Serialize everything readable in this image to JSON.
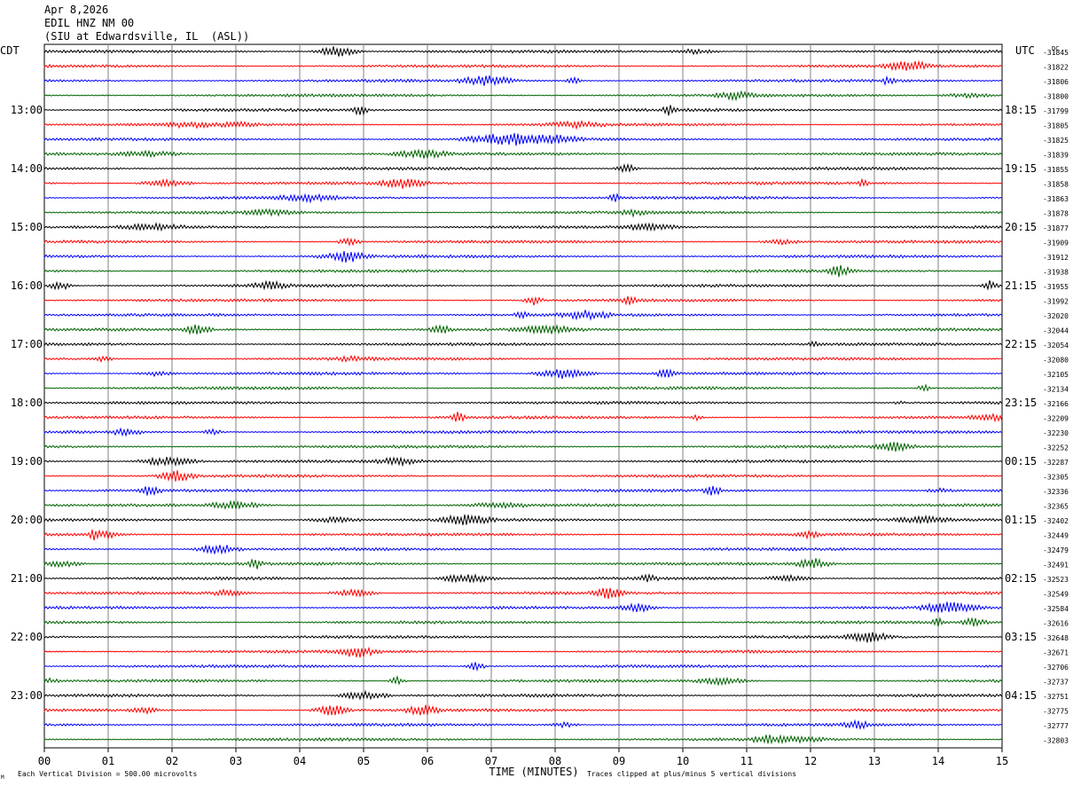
{
  "header": {
    "date": "Apr 8,2026",
    "station": "EDIL HNZ NM 00",
    "location": "(SIU at Edwardsville, IL  (ASL))"
  },
  "chart_data": {
    "type": "line",
    "description_type": "helicorder seismogram",
    "left_timezone": "CDT",
    "right_timezone": "UTC",
    "dc_label": "DC",
    "x_ticks": [
      "00",
      "01",
      "02",
      "03",
      "04",
      "05",
      "06",
      "07",
      "08",
      "09",
      "10",
      "11",
      "12",
      "13",
      "14",
      "15"
    ],
    "xlim": [
      0,
      15
    ],
    "xlabel": "TIME (MINUTES)",
    "left_hour_labels": [
      "13:00",
      "14:00",
      "15:00",
      "16:00",
      "17:00",
      "18:00",
      "19:00",
      "20:00",
      "21:00",
      "22:00",
      "23:00"
    ],
    "right_hour_labels": [
      "18:15",
      "19:15",
      "20:15",
      "21:15",
      "22:15",
      "23:15",
      "00:15",
      "01:15",
      "02:15",
      "03:15",
      "04:15"
    ],
    "trace_colors": [
      "#000000",
      "#ff0000",
      "#0000ff",
      "#006400"
    ],
    "dc_offsets": [
      "-31845",
      "-31822",
      "-31806",
      "-31800",
      "-31799",
      "-31805",
      "-31825",
      "-31839",
      "-31855",
      "-31858",
      "-31863",
      "-31878",
      "-31877",
      "-31909",
      "-31912",
      "-31938",
      "-31955",
      "-31992",
      "-32020",
      "-32044",
      "-32054",
      "-32080",
      "-32105",
      "-32134",
      "-32166",
      "-32209",
      "-32230",
      "-32252",
      "-32287",
      "-32305",
      "-32336",
      "-32365",
      "-32402",
      "-32449",
      "-32479",
      "-32491",
      "-32523",
      "-32549",
      "-32584",
      "-32616",
      "-32648",
      "-32671",
      "-32706",
      "-32737",
      "-32751",
      "-32775",
      "-32777",
      "-32803"
    ],
    "grid": true,
    "footer": {
      "vertical_division": "Each Vertical Division =  500.00 microvolts",
      "clipping": "Traces clipped at plus/minus 5 vertical divisions",
      "corner_mark": "M"
    }
  }
}
